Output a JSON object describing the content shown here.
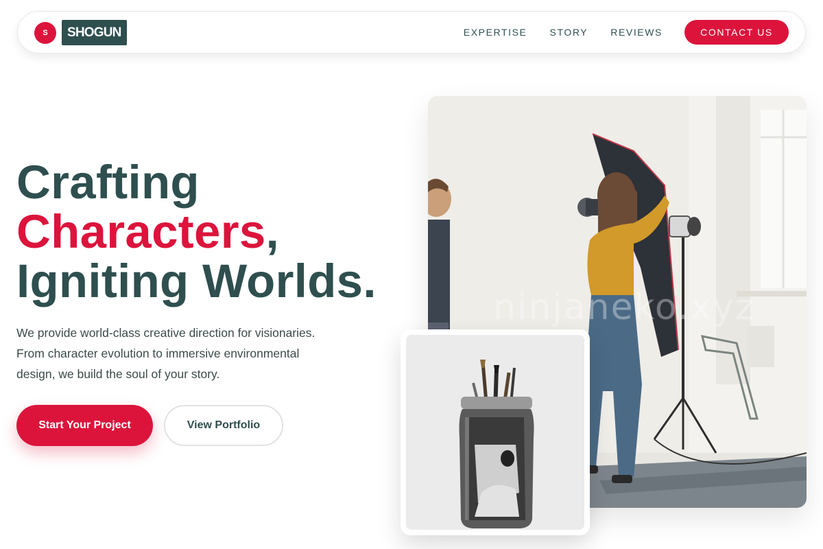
{
  "brand": {
    "mark": "S",
    "name": "SHOGUN"
  },
  "nav": {
    "links": [
      "EXPERTISE",
      "STORY",
      "REVIEWS"
    ],
    "cta": "CONTACT US"
  },
  "hero": {
    "title_line1": "Crafting",
    "title_line2_accent": "Characters",
    "title_line2_rest": ",",
    "title_line3": "Igniting Worlds.",
    "description": "We provide world-class creative direction for visionaries. From character evolution to immersive environmental design, we build the soul of your story.",
    "primary_button": "Start Your Project",
    "secondary_button": "View Portfolio"
  },
  "media": {
    "main_photo_watermark": "ninjaneko.xyz"
  },
  "colors": {
    "accent": "#dc143c",
    "primary": "#2f4f4f"
  }
}
